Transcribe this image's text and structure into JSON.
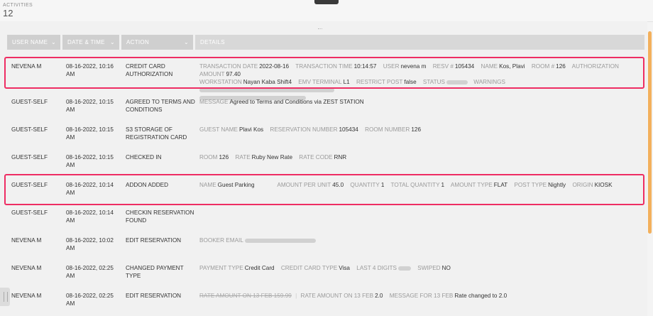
{
  "header": {
    "label": "ACTIVITIES",
    "count": "12"
  },
  "columns": {
    "user": "USER NAME",
    "date": "DATE & TIME",
    "action": "ACTION",
    "details": "DETAILS",
    "chevron": "⌄"
  },
  "rows": [
    {
      "user": "NEVENA M",
      "date_a": "08-16-2022, 10:16",
      "date_b": "AM",
      "action_a": "CREDIT CARD",
      "action_b": "AUTHORIZATION",
      "d": {
        "k1": "TRANSACTION DATE",
        "v1": "2022-08-16",
        "k2": "TRANSACTION TIME",
        "v2": "10:14:57",
        "k3": "USER",
        "v3": "nevena m",
        "k4": "RESV #",
        "v4": "105434",
        "k5": "NAME",
        "v5": "Kos, Plavi",
        "k6": "ROOM #",
        "v6": "126",
        "k7": "AUTHORIZATION AMOUNT",
        "v7": "97.40",
        "k8": "WORKSTATION",
        "v8": "Nayan Kaba Shift4",
        "k9": "EMV TERMINAL",
        "v9": "L1",
        "k10": "RESTRICT POST",
        "v10": "false",
        "k11": "STATUS",
        "k12": "WARNINGS"
      }
    },
    {
      "user": "GUEST-SELF",
      "date_a": "08-16-2022, 10:15",
      "date_b": "AM",
      "action_a": "AGREED TO TERMS AND",
      "action_b": "CONDITIONS",
      "d": {
        "k1": "MESSAGE",
        "v1": "Agreed to Terms and Conditions via ZEST STATION"
      }
    },
    {
      "user": "GUEST-SELF",
      "date_a": "08-16-2022, 10:15",
      "date_b": "AM",
      "action_a": "S3 STORAGE OF",
      "action_b": "REGISTRATION CARD",
      "d": {
        "k1": "GUEST NAME",
        "v1": "Plavi Kos",
        "k2": "RESERVATION NUMBER",
        "v2": "105434",
        "k3": "ROOM NUMBER",
        "v3": "126"
      }
    },
    {
      "user": "GUEST-SELF",
      "date_a": "08-16-2022, 10:15",
      "date_b": "AM",
      "action_a": "CHECKED IN",
      "action_b": "",
      "d": {
        "k1": "ROOM",
        "v1": "126",
        "k2": "RATE",
        "v2": "Ruby New Rate",
        "k3": "RATE CODE",
        "v3": "RNR"
      }
    },
    {
      "user": "GUEST-SELF",
      "date_a": "08-16-2022, 10:14",
      "date_b": "AM",
      "action_a": "ADDON ADDED",
      "action_b": "",
      "d": {
        "k1": "NAME",
        "v1": "Guest Parking",
        "k2": "AMOUNT PER UNIT",
        "v2": "45.0",
        "k3": "QUANTITY",
        "v3": "1",
        "k4": "TOTAL QUANTITY",
        "v4": "1",
        "k5": "AMOUNT TYPE",
        "v5": "FLAT",
        "k6": "POST TYPE",
        "v6": "Nightly",
        "k7": "ORIGIN",
        "v7": "KIOSK"
      }
    },
    {
      "user": "GUEST-SELF",
      "date_a": "08-16-2022, 10:14",
      "date_b": "AM",
      "action_a": "CHECKIN RESERVATION",
      "action_b": "FOUND",
      "d": {}
    },
    {
      "user": "NEVENA M",
      "date_a": "08-16-2022, 10:02",
      "date_b": "AM",
      "action_a": "EDIT RESERVATION",
      "action_b": "",
      "d": {
        "k1": "BOOKER EMAIL"
      }
    },
    {
      "user": "NEVENA M",
      "date_a": "08-16-2022, 02:25",
      "date_b": "AM",
      "action_a": "CHANGED PAYMENT",
      "action_b": "TYPE",
      "d": {
        "k1": "PAYMENT TYPE",
        "v1": "Credit Card",
        "k2": "CREDIT CARD TYPE",
        "v2": "Visa",
        "k3": "LAST 4 DIGITS",
        "k4": "SWIPED",
        "v4": "NO"
      }
    },
    {
      "user": "NEVENA M",
      "date_a": "08-16-2022, 02:25",
      "date_b": "AM",
      "action_a": "EDIT RESERVATION",
      "action_b": "",
      "d": {
        "s1": "RATE AMOUNT ON 13 FEB 159.99",
        "k1": "RATE AMOUNT ON 13 FEB",
        "v1": "2.0",
        "k2": "MESSAGE FOR 13 FEB",
        "v2": "Rate changed to 2.0"
      }
    }
  ]
}
